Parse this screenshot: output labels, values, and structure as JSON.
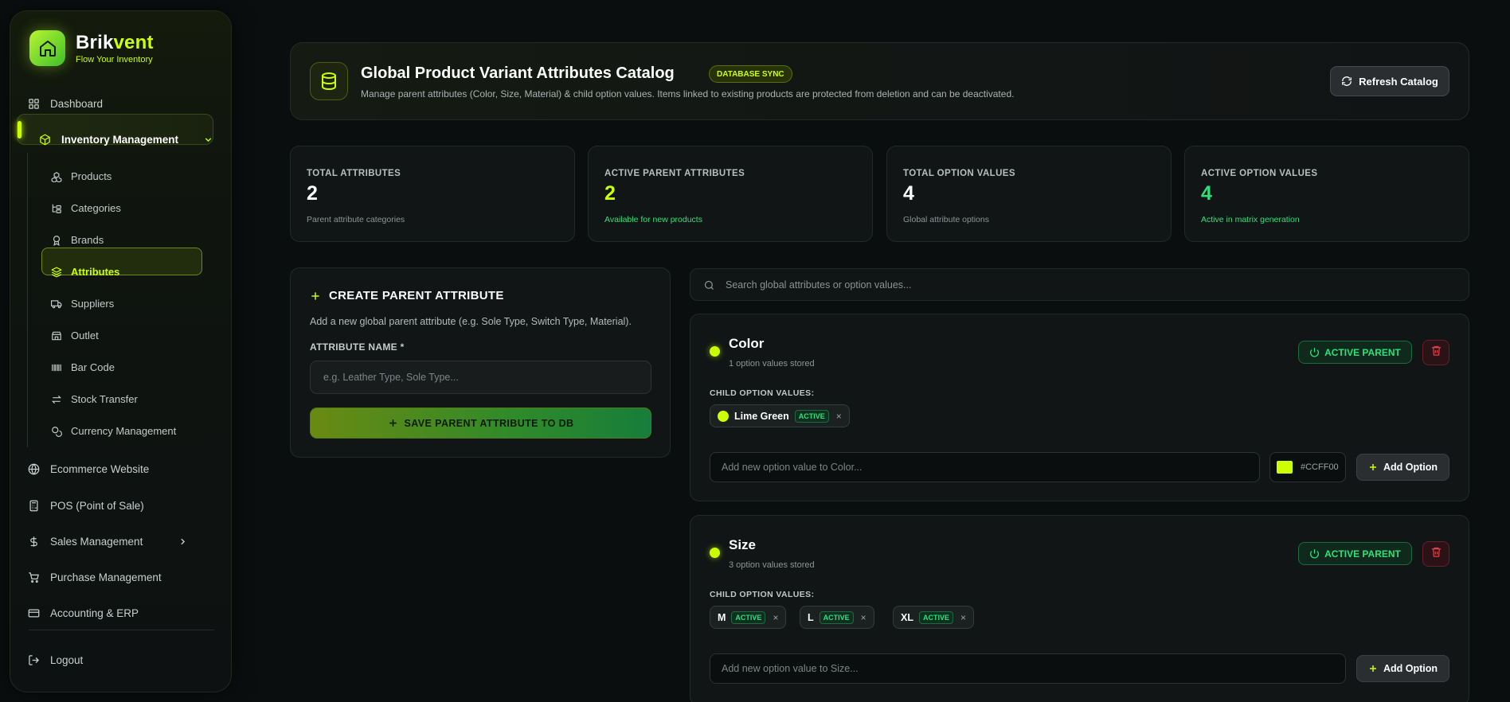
{
  "brand": {
    "name_main": "Brik",
    "name_accent": "vent",
    "tagline": "Flow Your Inventory"
  },
  "sidebar": {
    "dashboard": "Dashboard",
    "inventory": "Inventory Management",
    "sub_items": [
      "Products",
      "Categories",
      "Brands",
      "Attributes",
      "Suppliers",
      "Outlet",
      "Bar Code",
      "Stock Transfer",
      "Currency Management"
    ],
    "ecommerce": "Ecommerce Website",
    "pos": "POS (Point of Sale)",
    "sales": "Sales Management",
    "purchase": "Purchase Management",
    "accounting": "Accounting & ERP",
    "logout": "Logout"
  },
  "header": {
    "title": "Global Product Variant Attributes Catalog",
    "badge": "DATABASE SYNC",
    "description": "Manage parent attributes (Color, Size, Material) & child option values. Items linked to existing products are protected from deletion and can be deactivated.",
    "refresh_label": "Refresh Catalog"
  },
  "stats": [
    {
      "label": "TOTAL ATTRIBUTES",
      "value": "2",
      "sub": "Parent attribute categories",
      "color": "#ffffff",
      "sub_color": "#8c9595"
    },
    {
      "label": "ACTIVE PARENT ATTRIBUTES",
      "value": "2",
      "sub": "Available for new products",
      "color": "#ccff00",
      "sub_color": "#2ee07a"
    },
    {
      "label": "TOTAL OPTION VALUES",
      "value": "4",
      "sub": "Global attribute options",
      "color": "#ffffff",
      "sub_color": "#8c9595"
    },
    {
      "label": "ACTIVE OPTION VALUES",
      "value": "4",
      "sub": "Active in matrix generation",
      "color": "#2ee07a",
      "sub_color": "#2ee07a"
    }
  ],
  "create": {
    "title": "CREATE PARENT ATTRIBUTE",
    "description": "Add a new global parent attribute (e.g. Sole Type, Switch Type, Material).",
    "field_label": "ATTRIBUTE NAME *",
    "placeholder": "e.g. Leather Type, Sole Type...",
    "save_label": "SAVE PARENT ATTRIBUTE TO DB"
  },
  "search": {
    "placeholder": "Search global attributes or option values..."
  },
  "attributes": [
    {
      "name": "Color",
      "count": "1 option values stored",
      "status": "ACTIVE PARENT",
      "child_label": "CHILD OPTION VALUES:",
      "options": [
        {
          "name": "Lime Green",
          "badge": "ACTIVE",
          "x": "×"
        }
      ],
      "placeholder": "Add new option value to Color...",
      "hex": "#CCFF00",
      "add_label": "Add Option"
    },
    {
      "name": "Size",
      "count": "3 option values stored",
      "status": "ACTIVE PARENT",
      "child_label": "CHILD OPTION VALUES:",
      "options": [
        {
          "name": "M",
          "badge": "ACTIVE",
          "x": "×"
        },
        {
          "name": "L",
          "badge": "ACTIVE",
          "x": "×"
        },
        {
          "name": "XL",
          "badge": "ACTIVE",
          "x": "×"
        }
      ],
      "placeholder": "Add new option value to Size...",
      "add_label": "Add Option"
    }
  ],
  "colors": {
    "accent": "#ccff00",
    "success": "#2ee07a",
    "danger": "#e0404e"
  }
}
